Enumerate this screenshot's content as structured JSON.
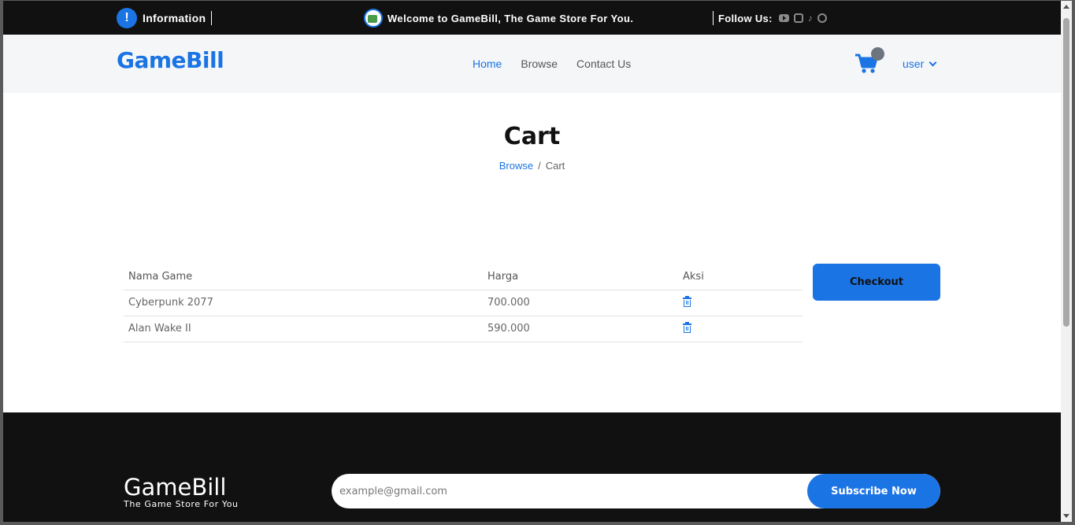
{
  "topbar": {
    "info_label": "Information",
    "welcome_text": "Welcome to GameBill, The Game Store For You.",
    "follow_label": "Follow Us:",
    "social_icons": [
      "youtube-icon",
      "instagram-icon",
      "tiktok-icon",
      "whatsapp-icon"
    ]
  },
  "navbar": {
    "brand": "GameBill",
    "links": [
      {
        "label": "Home",
        "active": true
      },
      {
        "label": "Browse",
        "active": false
      },
      {
        "label": "Contact Us",
        "active": false
      }
    ],
    "user_label": "user"
  },
  "page": {
    "title": "Cart",
    "breadcrumb": [
      {
        "label": "Browse",
        "link": true
      },
      {
        "label": "Cart",
        "link": false
      }
    ]
  },
  "cart_table": {
    "headers": [
      "Nama Game",
      "Harga",
      "Aksi"
    ],
    "rows": [
      {
        "name": "Cyberpunk 2077",
        "price": "700.000"
      },
      {
        "name": "Alan Wake II",
        "price": "590.000"
      }
    ]
  },
  "checkout_label": "Checkout",
  "footer": {
    "brand": "GameBill",
    "tagline": "The Game Store For You",
    "email_placeholder": "example@gmail.com",
    "subscribe_label": "Subscribe Now"
  },
  "colors": {
    "accent": "#1b74e4",
    "dark": "#111111",
    "nav_bg": "#f4f6f8"
  }
}
